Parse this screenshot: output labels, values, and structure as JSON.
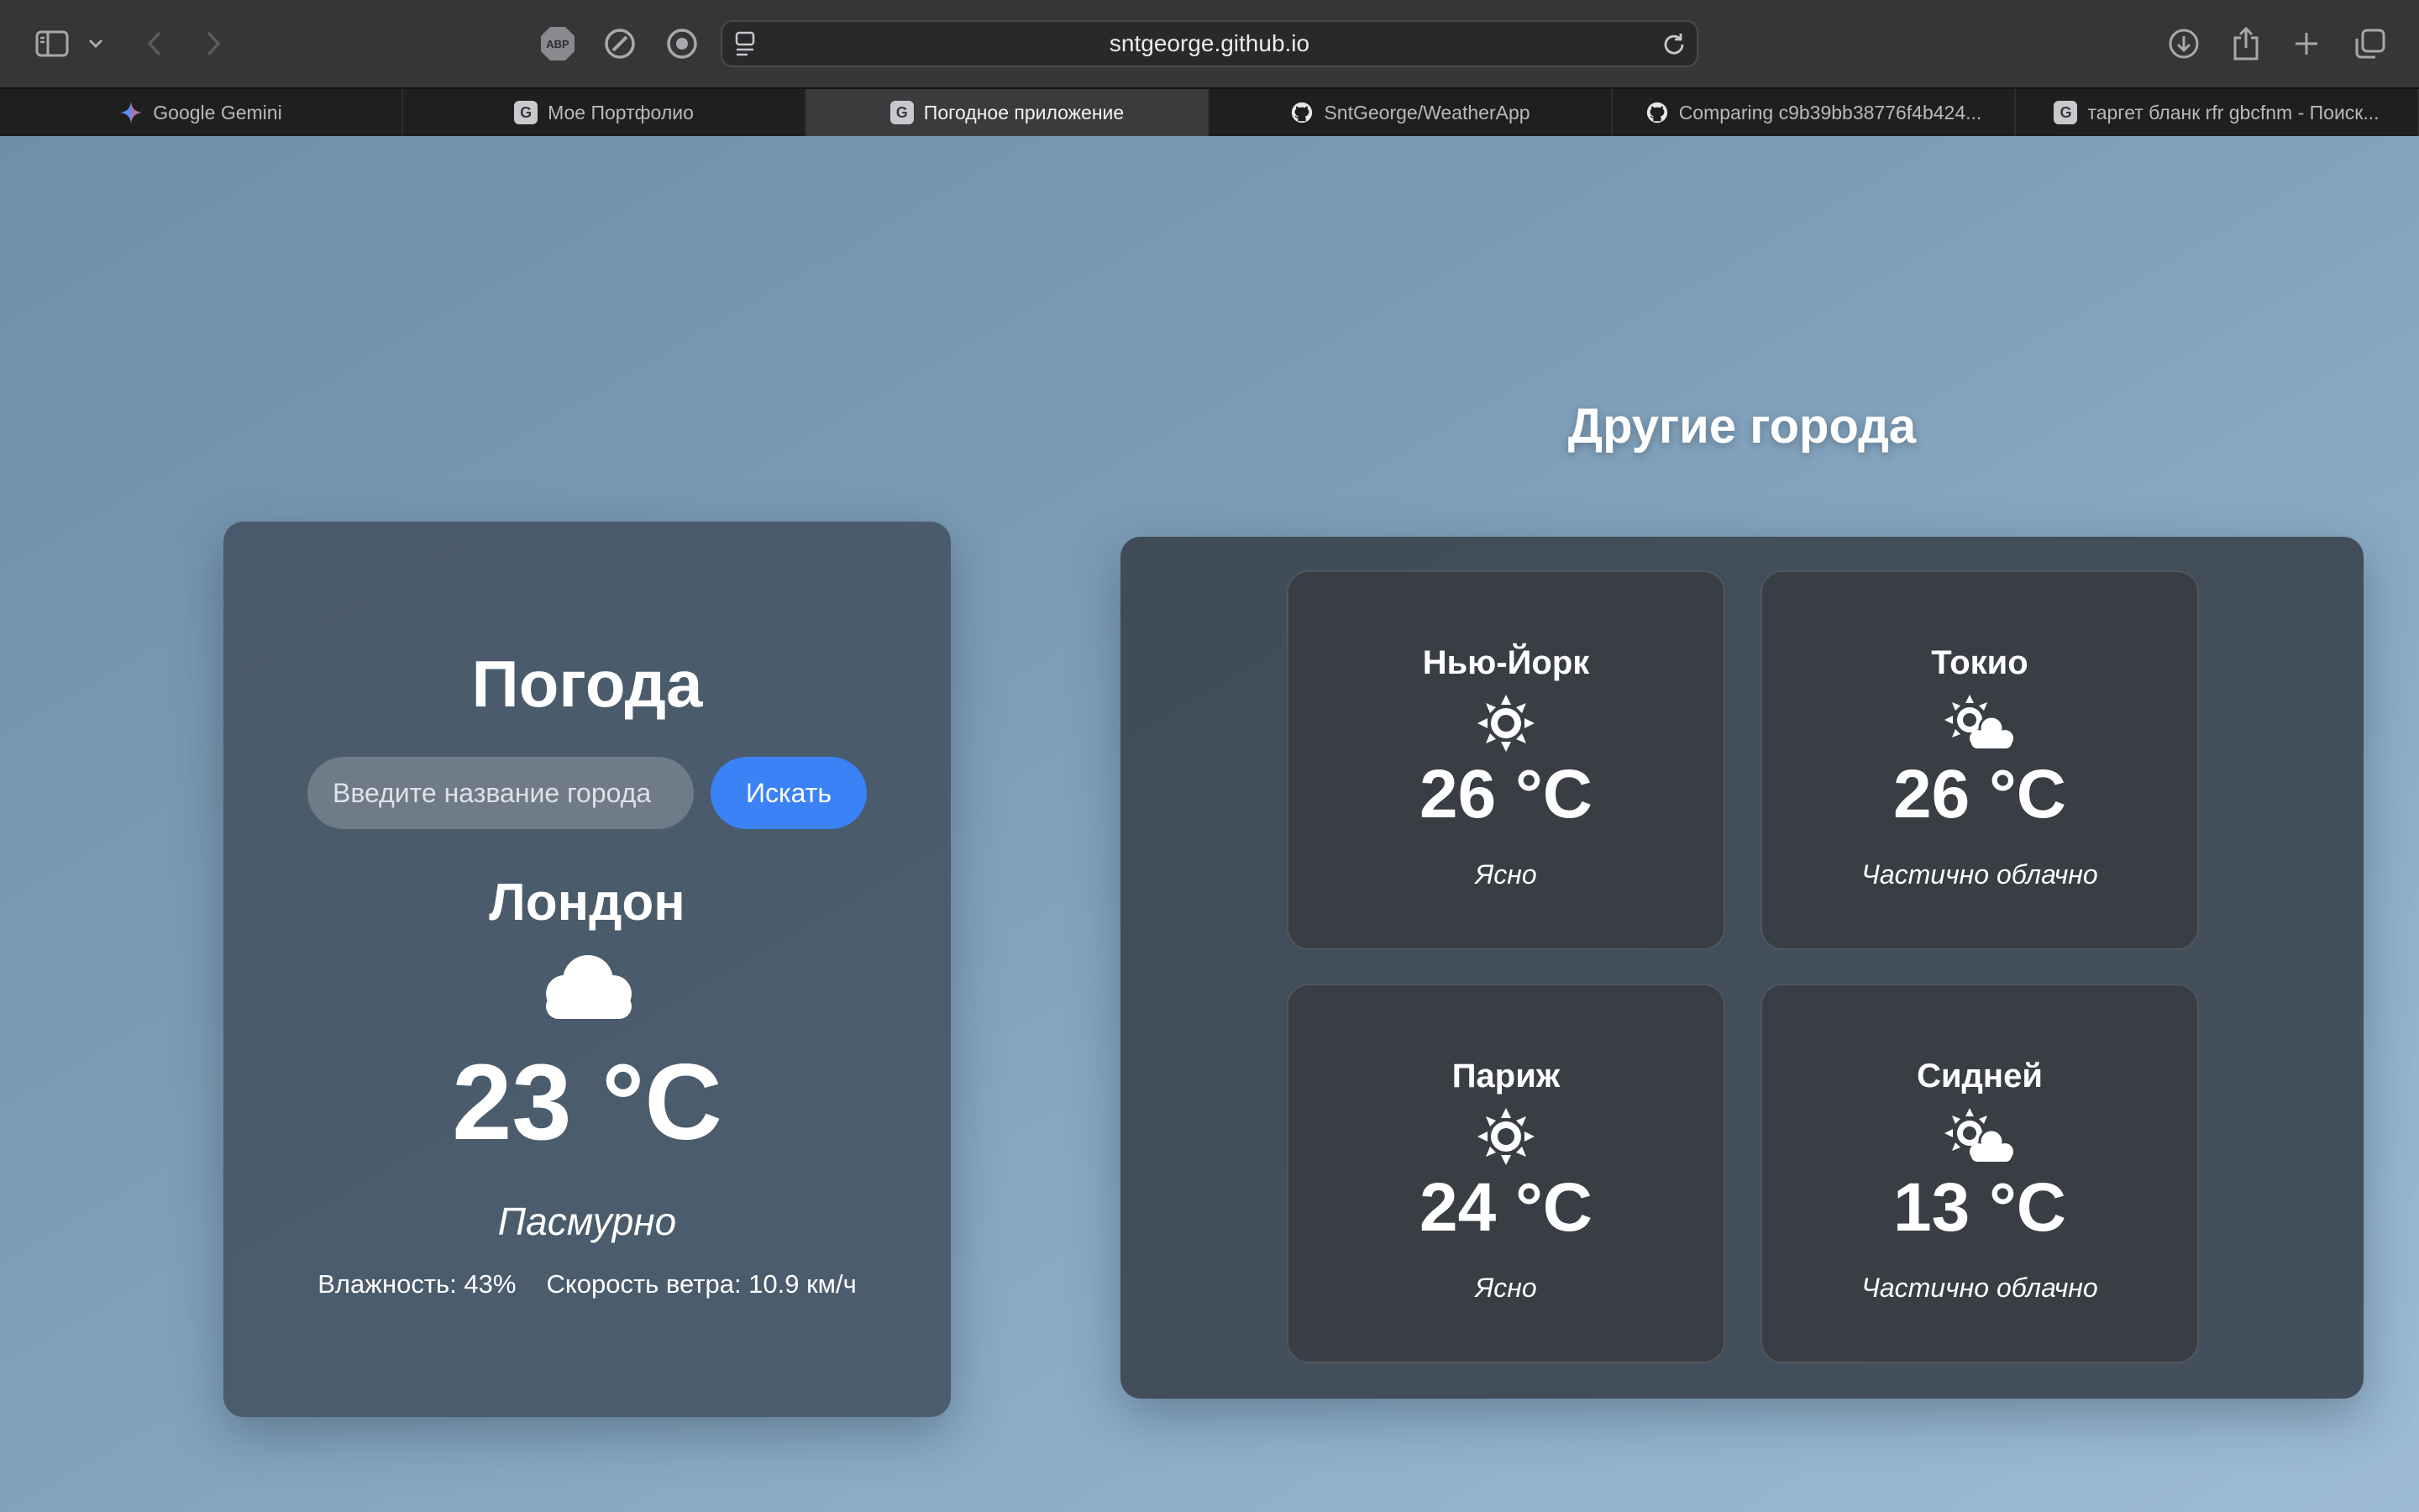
{
  "browser": {
    "url": "sntgeorge.github.io",
    "tabs": [
      {
        "label": "Google Gemini",
        "favicon": "gemini-icon",
        "active": false
      },
      {
        "label": "Мое Портфолио",
        "favicon": "G",
        "active": false
      },
      {
        "label": "Погодное приложение",
        "favicon": "G",
        "active": true
      },
      {
        "label": "SntGeorge/WeatherApp",
        "favicon": "github-icon",
        "active": false
      },
      {
        "label": "Comparing c9b39bb38776f4b424...",
        "favicon": "github-icon",
        "active": false
      },
      {
        "label": "таргет бланк rfr gbcfnm - Поиск...",
        "favicon": "G",
        "active": false
      }
    ],
    "adblock_label": "ABP"
  },
  "main": {
    "title": "Погода",
    "search": {
      "placeholder": "Введите название города",
      "value": "",
      "button_label": "Искать"
    },
    "city": "Лондон",
    "icon": "cloud-icon",
    "temperature": "23 °C",
    "description": "Пасмурно",
    "humidity": "Влажность: 43%",
    "wind": "Скорость ветра: 10.9 км/ч"
  },
  "others": {
    "title": "Другие города",
    "cities": [
      {
        "name": "Нью-Йорк",
        "icon": "sun-icon",
        "temperature": "26 °C",
        "description": "Ясно"
      },
      {
        "name": "Токио",
        "icon": "partly-cloudy-icon",
        "temperature": "26 °C",
        "description": "Частично облачно"
      },
      {
        "name": "Париж",
        "icon": "sun-icon",
        "temperature": "24 °C",
        "description": "Ясно"
      },
      {
        "name": "Сидней",
        "icon": "partly-cloudy-icon",
        "temperature": "13 °C",
        "description": "Частично облачно"
      }
    ]
  },
  "colors": {
    "accent": "#3b82f6",
    "card": "#435261",
    "page_gradient_start": "#6f8fa9",
    "page_gradient_end": "#9dbbd5"
  }
}
